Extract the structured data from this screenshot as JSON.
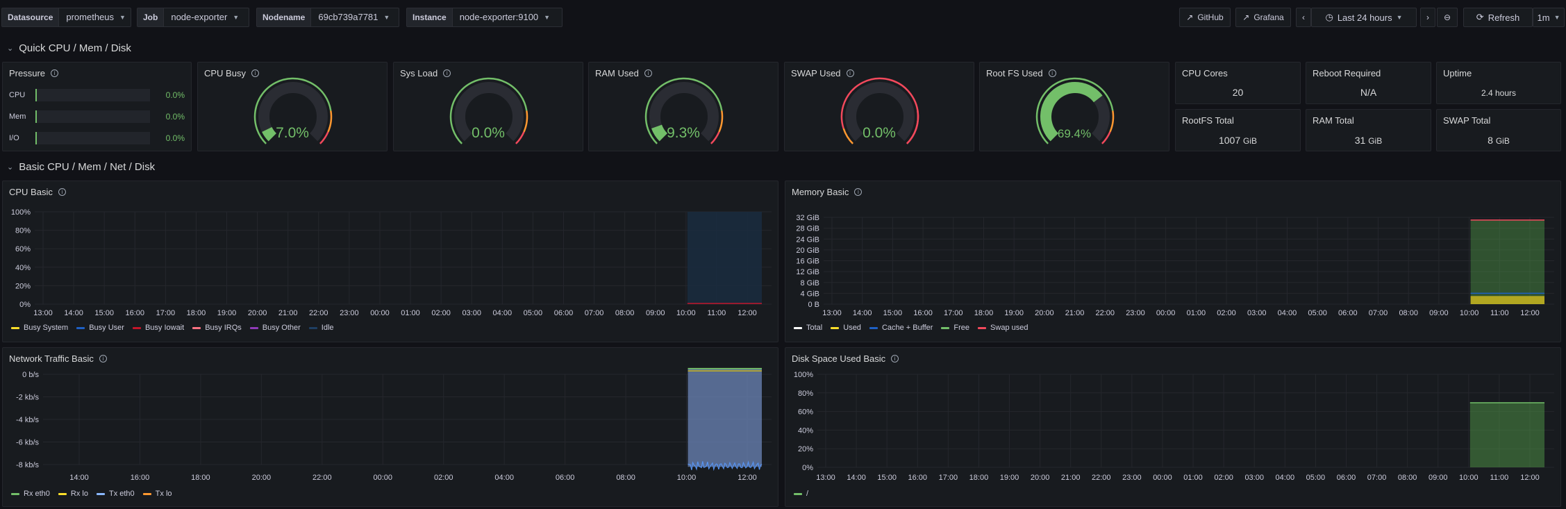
{
  "variables": [
    {
      "label": "Datasource",
      "value": "prometheus"
    },
    {
      "label": "Job",
      "value": "node-exporter"
    },
    {
      "label": "Nodename",
      "value": "69cb739a7781"
    },
    {
      "label": "Instance",
      "value": "node-exporter:9100"
    }
  ],
  "toolbar": {
    "github": "GitHub",
    "grafana": "Grafana",
    "time_range": "Last 24 hours",
    "refresh": "Refresh",
    "refresh_interval": "1m"
  },
  "sections": {
    "quick": "Quick CPU / Mem / Disk",
    "basic": "Basic CPU / Mem / Net / Disk"
  },
  "pressure": {
    "title": "Pressure",
    "rows": [
      {
        "label": "CPU",
        "value": "0.0%"
      },
      {
        "label": "Mem",
        "value": "0.0%"
      },
      {
        "label": "I/O",
        "value": "0.0%"
      }
    ]
  },
  "gauges": [
    {
      "title": "CPU Busy",
      "value": "7.0%",
      "fraction": 0.07
    },
    {
      "title": "Sys Load",
      "value": "0.0%",
      "fraction": 0.0
    },
    {
      "title": "RAM Used",
      "value": "9.3%",
      "fraction": 0.093
    },
    {
      "title": "SWAP Used",
      "value": "0.0%",
      "fraction": 0.0
    },
    {
      "title": "Root FS Used",
      "value": "69.4%",
      "fraction": 0.694
    }
  ],
  "stats": [
    {
      "title": "CPU Cores",
      "value": "20",
      "unit": ""
    },
    {
      "title": "Reboot Required",
      "value": "N/A",
      "unit": ""
    },
    {
      "title": "Uptime",
      "value": "2.4 hours",
      "unit": ""
    },
    {
      "title": "RootFS Total",
      "value": "1007",
      "unit": "GiB"
    },
    {
      "title": "RAM Total",
      "value": "31",
      "unit": "GiB"
    },
    {
      "title": "SWAP Total",
      "value": "8",
      "unit": "GiB"
    }
  ],
  "colors": {
    "green": "#73bf69",
    "yellow": "#fade2a",
    "blue": "#5794f2",
    "orange": "#ff9830",
    "red": "#f2495c"
  },
  "chart_data": [
    {
      "type": "area",
      "title": "CPU Basic",
      "x": [
        "13:00",
        "14:00",
        "15:00",
        "16:00",
        "17:00",
        "18:00",
        "19:00",
        "20:00",
        "21:00",
        "22:00",
        "23:00",
        "00:00",
        "01:00",
        "02:00",
        "03:00",
        "04:00",
        "05:00",
        "06:00",
        "07:00",
        "08:00",
        "09:00",
        "10:00",
        "11:00",
        "12:00"
      ],
      "y_ticks": [
        "100%",
        "80%",
        "60%",
        "40%",
        "20%",
        "0%"
      ],
      "ylim": [
        0,
        100
      ],
      "data_start": "10:00",
      "series": [
        {
          "name": "Busy System",
          "color": "#fade2a"
        },
        {
          "name": "Busy User",
          "color": "#1f60c4"
        },
        {
          "name": "Busy Iowait",
          "color": "#c4162a"
        },
        {
          "name": "Busy IRQs",
          "color": "#ff7383"
        },
        {
          "name": "Busy Other",
          "color": "#8f3bb8"
        },
        {
          "name": "Idle",
          "color": "#1f3f63"
        }
      ]
    },
    {
      "type": "area",
      "title": "Memory Basic",
      "x": [
        "13:00",
        "14:00",
        "15:00",
        "16:00",
        "17:00",
        "18:00",
        "19:00",
        "20:00",
        "21:00",
        "22:00",
        "23:00",
        "00:00",
        "01:00",
        "02:00",
        "03:00",
        "04:00",
        "05:00",
        "06:00",
        "07:00",
        "08:00",
        "09:00",
        "10:00",
        "11:00",
        "12:00"
      ],
      "y_ticks": [
        "32 GiB",
        "28 GiB",
        "24 GiB",
        "20 GiB",
        "16 GiB",
        "12 GiB",
        "8 GiB",
        "4 GiB",
        "0 B"
      ],
      "ylim": [
        0,
        32
      ],
      "data_start": "10:00",
      "series": [
        {
          "name": "Total",
          "color": "#ffffff",
          "value": 31
        },
        {
          "name": "Used",
          "color": "#fade2a",
          "value": 3
        },
        {
          "name": "Cache + Buffer",
          "color": "#1f60c4",
          "value": 1
        },
        {
          "name": "Free",
          "color": "#73bf69",
          "value": 27
        },
        {
          "name": "Swap used",
          "color": "#f2495c",
          "value": 0
        }
      ]
    },
    {
      "type": "area",
      "title": "Network Traffic Basic",
      "x": [
        "14:00",
        "16:00",
        "18:00",
        "20:00",
        "22:00",
        "00:00",
        "02:00",
        "04:00",
        "06:00",
        "08:00",
        "10:00",
        "12:00"
      ],
      "y_ticks": [
        "0 b/s",
        "-2 kb/s",
        "-4 kb/s",
        "-6 kb/s",
        "-8 kb/s"
      ],
      "ylim": [
        -9,
        1
      ],
      "data_start": "10:00",
      "series": [
        {
          "name": "Rx eth0",
          "color": "#73bf69"
        },
        {
          "name": "Rx lo",
          "color": "#fade2a"
        },
        {
          "name": "Tx eth0",
          "color": "#8ab8ff"
        },
        {
          "name": "Tx lo",
          "color": "#ff9830"
        }
      ]
    },
    {
      "type": "area",
      "title": "Disk Space Used Basic",
      "x": [
        "13:00",
        "14:00",
        "15:00",
        "16:00",
        "17:00",
        "18:00",
        "19:00",
        "20:00",
        "21:00",
        "22:00",
        "23:00",
        "00:00",
        "01:00",
        "02:00",
        "03:00",
        "04:00",
        "05:00",
        "06:00",
        "07:00",
        "08:00",
        "09:00",
        "10:00",
        "11:00",
        "12:00"
      ],
      "y_ticks": [
        "100%",
        "80%",
        "60%",
        "40%",
        "20%",
        "0%"
      ],
      "ylim": [
        0,
        100
      ],
      "data_start": "10:00",
      "series": [
        {
          "name": "/",
          "color": "#73bf69",
          "value": 69.4
        }
      ]
    }
  ]
}
